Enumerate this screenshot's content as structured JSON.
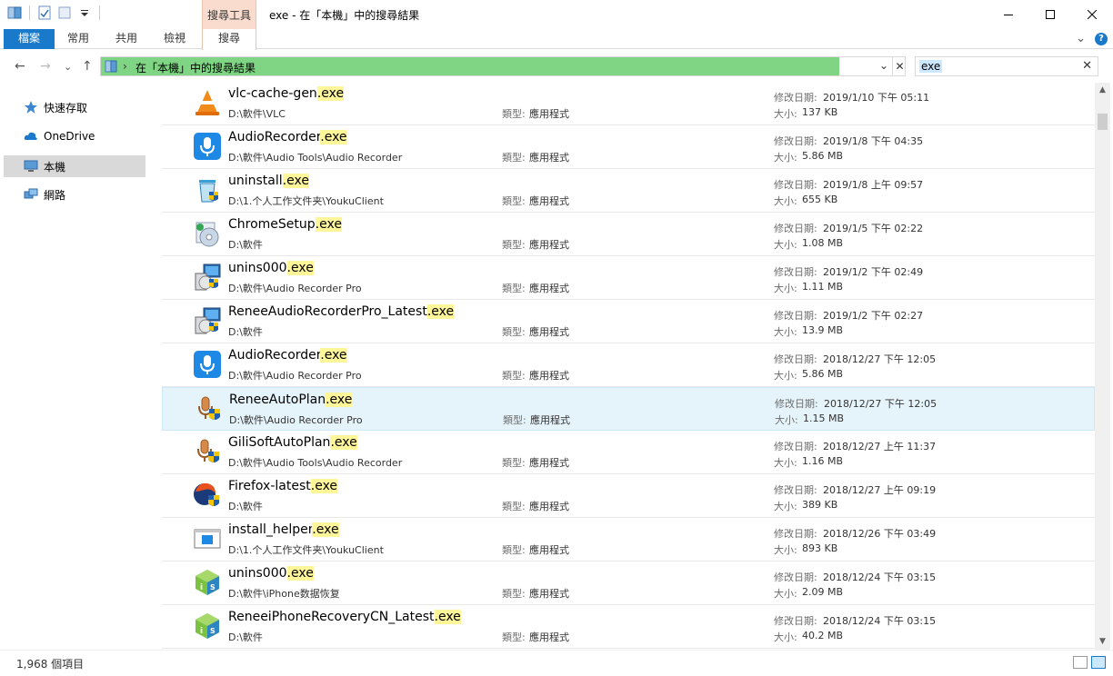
{
  "window": {
    "title": "exe - 在「本機」中的搜尋結果",
    "context_tab_header": "搜尋工具",
    "controls": {
      "minimize": "—",
      "maximize": "☐",
      "close": "✕"
    }
  },
  "ribbon": {
    "tabs": [
      {
        "label": "檔案"
      },
      {
        "label": "常用"
      },
      {
        "label": "共用"
      },
      {
        "label": "檢視"
      },
      {
        "label": "搜尋"
      }
    ],
    "expand_glyph": "⌄",
    "help_glyph": "?"
  },
  "nav": {
    "back": "←",
    "forward": "→",
    "recent": "⌄",
    "up": "↑",
    "address_sep": "›",
    "address_text": "在「本機」中的搜尋結果",
    "address_dropdown": "⌄",
    "address_clear": "✕",
    "search_value": "exe",
    "search_clear": "✕"
  },
  "sidebar": {
    "items": [
      {
        "label": "快速存取",
        "icon": "star-icon"
      },
      {
        "label": "OneDrive",
        "icon": "cloud-icon"
      },
      {
        "label": "本機",
        "icon": "computer-icon",
        "selected": true
      },
      {
        "label": "網路",
        "icon": "network-icon"
      }
    ]
  },
  "labels": {
    "type": "類型:",
    "date": "修改日期:",
    "size": "大小:",
    "ext": ".exe"
  },
  "files": [
    {
      "base": "vlc-cache-gen",
      "path": "D:\\軟件\\VLC",
      "type": "應用程式",
      "date": "2019/1/10 下午 05:11",
      "size": "137 KB",
      "icon": "vlc-icon"
    },
    {
      "base": "AudioRecorder",
      "path": "D:\\軟件\\Audio Tools\\Audio Recorder",
      "type": "應用程式",
      "date": "2019/1/8 下午 04:35",
      "size": "5.86 MB",
      "icon": "microphone-icon"
    },
    {
      "base": "uninstall",
      "path": "D:\\1.个人工作文件夹\\YoukuClient",
      "type": "應用程式",
      "date": "2019/1/8 上午 09:57",
      "size": "655 KB",
      "icon": "recycle-bin-icon"
    },
    {
      "base": "ChromeSetup",
      "path": "D:\\軟件",
      "type": "應用程式",
      "date": "2019/1/5 下午 02:22",
      "size": "1.08 MB",
      "icon": "setup-cd-icon"
    },
    {
      "base": "unins000",
      "path": "D:\\軟件\\Audio Recorder Pro",
      "type": "應用程式",
      "date": "2019/1/2 下午 02:49",
      "size": "1.11 MB",
      "icon": "installer-icon"
    },
    {
      "base": "ReneeAudioRecorderPro_Latest",
      "path": "D:\\軟件",
      "type": "應用程式",
      "date": "2019/1/2 下午 02:27",
      "size": "13.9 MB",
      "icon": "installer-icon"
    },
    {
      "base": "AudioRecorder",
      "path": "D:\\軟件\\Audio Recorder Pro",
      "type": "應用程式",
      "date": "2018/12/27 下午 12:05",
      "size": "5.86 MB",
      "icon": "microphone-icon"
    },
    {
      "base": "ReneeAutoPlan",
      "path": "D:\\軟件\\Audio Recorder Pro",
      "type": "應用程式",
      "date": "2018/12/27 下午 12:05",
      "size": "1.15 MB",
      "icon": "mic-shield-icon",
      "selected": true
    },
    {
      "base": "GiliSoftAutoPlan",
      "path": "D:\\軟件\\Audio Tools\\Audio Recorder",
      "type": "應用程式",
      "date": "2018/12/27 上午 11:37",
      "size": "1.16 MB",
      "icon": "mic-shield-icon"
    },
    {
      "base": "Firefox-latest",
      "path": "D:\\軟件",
      "type": "應用程式",
      "date": "2018/12/27 上午 09:19",
      "size": "389 KB",
      "icon": "firefox-shield-icon"
    },
    {
      "base": "install_helper",
      "path": "D:\\1.个人工作文件夹\\YoukuClient",
      "type": "應用程式",
      "date": "2018/12/26 下午 03:49",
      "size": "893 KB",
      "icon": "app-window-icon"
    },
    {
      "base": "unins000",
      "path": "D:\\軟件\\iPhone数据恢复",
      "type": "應用程式",
      "date": "2018/12/24 下午 03:15",
      "size": "2.09 MB",
      "icon": "ios-cube-icon"
    },
    {
      "base": "ReneeiPhoneRecoveryCN_Latest",
      "path": "D:\\軟件",
      "type": "應用程式",
      "date": "2018/12/24 下午 03:15",
      "size": "40.2 MB",
      "icon": "ios-cube-icon"
    }
  ],
  "status": {
    "count": "1,968 個項目"
  },
  "colors": {
    "accent": "#1979ca",
    "context_tab": "#f9dccd",
    "progress": "#7fd583",
    "highlight": "#fef699",
    "selection": "#e5f3fb"
  }
}
